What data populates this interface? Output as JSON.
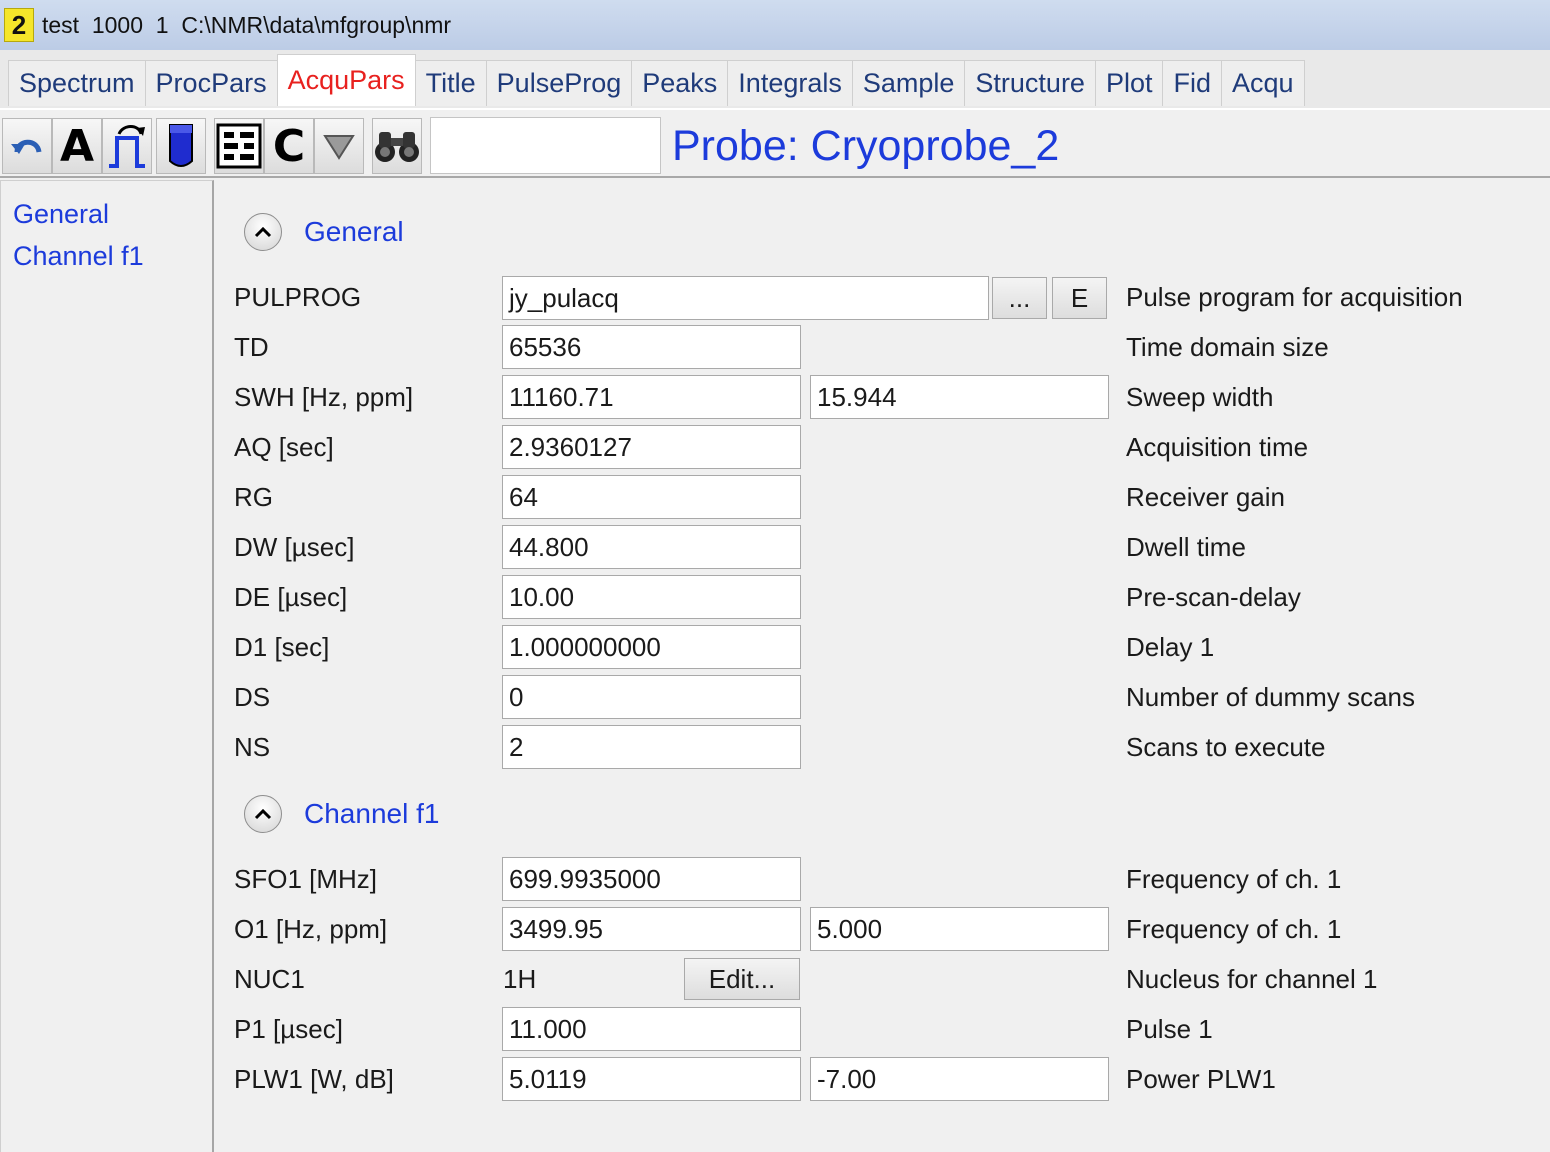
{
  "window": {
    "number": "2",
    "title": "test  1000  1  C:\\NMR\\data\\mfgroup\\nmr"
  },
  "tabs": [
    "Spectrum",
    "ProcPars",
    "AcquPars",
    "Title",
    "PulseProg",
    "Peaks",
    "Integrals",
    "Sample",
    "Structure",
    "Plot",
    "Fid",
    "Acqu"
  ],
  "active_tab": "AcquPars",
  "toolbar": {
    "icons": [
      "undo-icon",
      "font-a-icon",
      "pulse-icon",
      "sample-tube-icon",
      "grid-table-icon",
      "c-letter-icon",
      "filter-triangle-icon",
      "binoculars-icon"
    ],
    "a_label": "A",
    "c_label": "C",
    "search_value": "",
    "probe_label": "Probe: Cryoprobe_2"
  },
  "nav": {
    "items": [
      "General",
      "Channel f1"
    ]
  },
  "sections": {
    "general": {
      "title": "General",
      "params": {
        "pulprog": {
          "label": "PULPROG",
          "value": "jy_pulacq",
          "browse": "...",
          "edit": "E",
          "desc": "Pulse program for acquisition"
        },
        "td": {
          "label": "TD",
          "value": "65536",
          "desc": "Time domain size"
        },
        "swh": {
          "label": "SWH [Hz, ppm]",
          "value": "11160.71",
          "value2": "15.944",
          "desc": "Sweep width"
        },
        "aq": {
          "label": "AQ [sec]",
          "value": "2.9360127",
          "desc": "Acquisition time"
        },
        "rg": {
          "label": "RG",
          "value": "64",
          "desc": "Receiver gain"
        },
        "dw": {
          "label": "DW [µsec]",
          "value": "44.800",
          "desc": "Dwell time"
        },
        "de": {
          "label": "DE [µsec]",
          "value": "10.00",
          "desc": "Pre-scan-delay"
        },
        "d1": {
          "label": "D1 [sec]",
          "value": "1.000000000",
          "desc": "Delay 1"
        },
        "ds": {
          "label": "DS",
          "value": "0",
          "desc": "Number of dummy scans"
        },
        "ns": {
          "label": "NS",
          "value": "2",
          "desc": "Scans to execute"
        }
      }
    },
    "channel_f1": {
      "title": "Channel f1",
      "params": {
        "sfo1": {
          "label": "SFO1 [MHz]",
          "value": "699.9935000",
          "desc": "Frequency of ch. 1"
        },
        "o1": {
          "label": "O1 [Hz, ppm]",
          "value": "3499.95",
          "value2": "5.000",
          "desc": "Frequency of ch. 1"
        },
        "nuc1": {
          "label": "NUC1",
          "value": "1H",
          "edit": "Edit...",
          "desc": "Nucleus for channel 1"
        },
        "p1": {
          "label": "P1 [µsec]",
          "value": "11.000",
          "desc": "Pulse 1"
        },
        "plw1": {
          "label": "PLW1 [W, dB]",
          "value": "5.0119",
          "value2": "-7.00",
          "desc": "Power PLW1"
        }
      }
    }
  },
  "colors": {
    "link_blue": "#1c3bdb",
    "active_tab_red": "#e8211f",
    "window_number_yellow": "#f5e62a"
  }
}
